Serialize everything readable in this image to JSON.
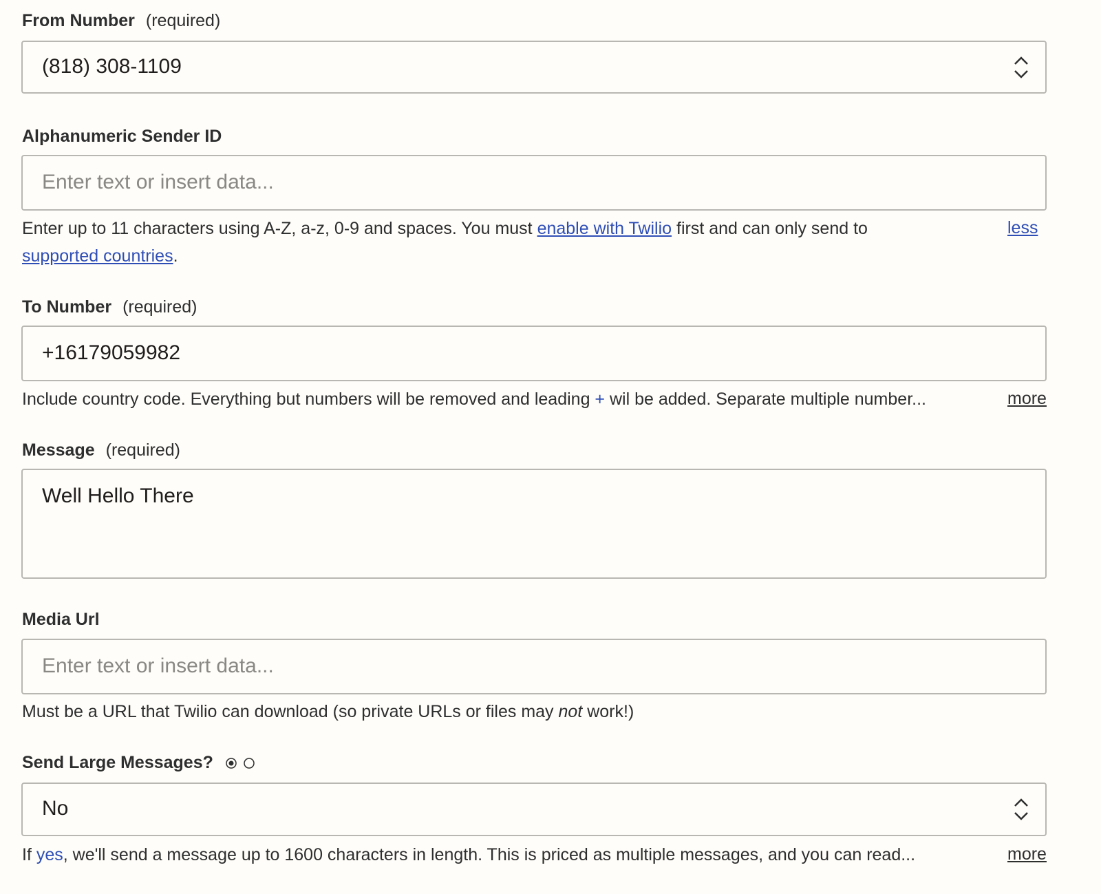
{
  "from_number": {
    "label": "From Number",
    "required": "(required)",
    "value": "(818) 308-1109"
  },
  "sender_id": {
    "label": "Alphanumeric Sender ID",
    "placeholder": "Enter text or insert data...",
    "help_line1_a": "Enter up to 11 characters using A-Z, a-z, 0-9 and spaces. You must ",
    "help_link_twilio": "enable with Twilio",
    "help_line1_b": " first and can only send to",
    "help_link_countries": "supported countries",
    "help_line2_end": ".",
    "toggle": "less"
  },
  "to_number": {
    "label": "To Number",
    "required": "(required)",
    "value": "+16179059982",
    "help_a": "Include country code. Everything but numbers will be removed and leading ",
    "help_plus": "+",
    "help_b": " wil be added. Separate multiple number...",
    "toggle": "more"
  },
  "message": {
    "label": "Message",
    "required": "(required)",
    "value": "Well Hello There"
  },
  "media_url": {
    "label": "Media Url",
    "placeholder": "Enter text or insert data...",
    "help_a": "Must be a URL that Twilio can download (so private URLs or files may ",
    "help_em": "not",
    "help_b": " work!)"
  },
  "send_large": {
    "label": "Send Large Messages?",
    "value": "No",
    "help_if": "If ",
    "help_yes": "yes",
    "help_rest": ", we'll send a message up to 1600 characters in length. This is priced as multiple messages, and you can read...",
    "toggle": "more"
  },
  "colors": {
    "background": "#fffdf9",
    "border": "#b9b7b2",
    "link": "#2e4eb6",
    "placeholder": "#8a8884"
  }
}
